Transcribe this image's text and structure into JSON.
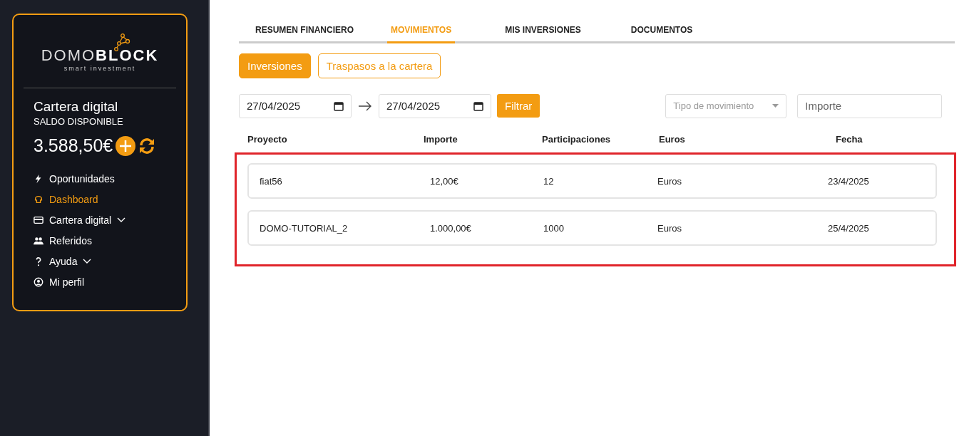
{
  "sidebar": {
    "logo": {
      "word_light": "DOMO",
      "word_bold": "BLOCK",
      "tagline": "smart investment"
    },
    "wallet": {
      "title": "Cartera digital",
      "subtitle": "SALDO DISPONIBLE",
      "balance": "3.588,50€"
    },
    "nav": [
      {
        "label": "Oportunidades",
        "selected": false,
        "expandable": false
      },
      {
        "label": "Dashboard",
        "selected": true,
        "expandable": false
      },
      {
        "label": "Cartera digital",
        "selected": false,
        "expandable": true
      },
      {
        "label": "Referidos",
        "selected": false,
        "expandable": false
      },
      {
        "label": "Ayuda",
        "selected": false,
        "expandable": true
      },
      {
        "label": "Mi perfil",
        "selected": false,
        "expandable": false
      }
    ]
  },
  "tabs": [
    {
      "label": "RESUMEN FINANCIERO",
      "selected": false
    },
    {
      "label": "MOVIMIENTOS",
      "selected": true
    },
    {
      "label": "MIS INVERSIONES",
      "selected": false
    },
    {
      "label": "DOCUMENTOS",
      "selected": false
    }
  ],
  "segments": [
    {
      "label": "Inversiones",
      "selected": true
    },
    {
      "label": "Traspasos a la cartera",
      "selected": false
    }
  ],
  "filters": {
    "date_from": "27/04/2025",
    "date_to": "27/04/2025",
    "filter_button": "Filtrar",
    "type_select": {
      "placeholder": "Tipo de movimiento"
    },
    "amount": {
      "placeholder": "Importe"
    }
  },
  "table": {
    "columns": [
      "Proyecto",
      "Importe",
      "Participaciones",
      "Euros",
      "Fecha"
    ],
    "rows": [
      [
        "fiat56",
        "12,00€",
        "12",
        "Euros",
        "23/4/2025"
      ],
      [
        "DOMO-TUTORIAL_2",
        "1.000,00€",
        "1000",
        "Euros",
        "25/4/2025"
      ]
    ],
    "highlighted": true
  }
}
